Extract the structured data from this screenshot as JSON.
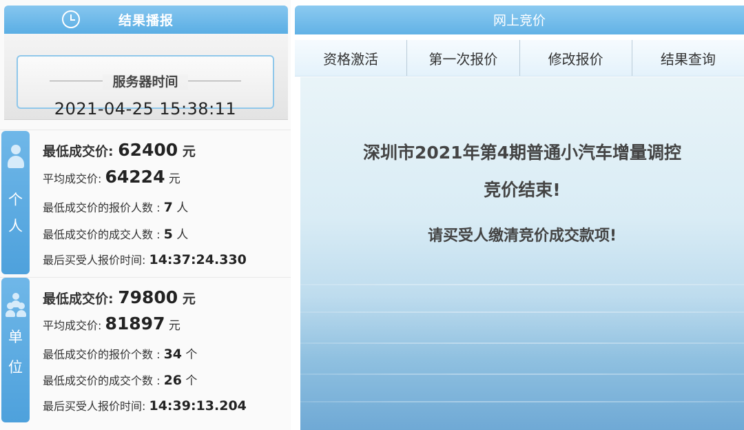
{
  "left_panel": {
    "header_title": "结果播报",
    "server_time_label": "服务器时间",
    "server_time_value": "2021-04-25 15:38:11"
  },
  "personal": {
    "tab_label_1": "个",
    "tab_label_2": "人",
    "lowest_price_label": "最低成交价: ",
    "lowest_price_value": "62400",
    "lowest_price_unit": " 元",
    "avg_price_label": "平均成交价: ",
    "avg_price_value": "64224",
    "avg_price_unit": " 元",
    "lowest_bid_count_label": "最低成交价的报价人数 : ",
    "lowest_bid_count_value": "7",
    "lowest_bid_count_unit": " 人",
    "lowest_deal_count_label": "最低成交价的成交人数 : ",
    "lowest_deal_count_value": "5",
    "lowest_deal_count_unit": " 人",
    "last_bid_time_label": "最后买受人报价时间: ",
    "last_bid_time_value": "14:37:24.330"
  },
  "unit": {
    "tab_label_1": "单",
    "tab_label_2": "位",
    "lowest_price_label": "最低成交价: ",
    "lowest_price_value": "79800",
    "lowest_price_unit": " 元",
    "avg_price_label": "平均成交价: ",
    "avg_price_value": "81897",
    "avg_price_unit": " 元",
    "lowest_bid_count_label": "最低成交价的报价个数 : ",
    "lowest_bid_count_value": "34",
    "lowest_bid_count_unit": " 个",
    "lowest_deal_count_label": "最低成交价的成交个数 : ",
    "lowest_deal_count_value": "26",
    "lowest_deal_count_unit": " 个",
    "last_bid_time_label": "最后买受人报价时间: ",
    "last_bid_time_value": "14:39:13.204"
  },
  "right_panel": {
    "header_title": "网上竞价",
    "tabs": [
      "资格激活",
      "第一次报价",
      "修改报价",
      "结果查询"
    ],
    "message_line1": "深圳市2021年第4期普通小汽车增量调控",
    "message_line2": "竞价结束!",
    "message_line3": "请买受人缴清竞价成交款项!"
  },
  "colors": {
    "accent_blue": "#5aaee4",
    "tab_blue": "#4ea1dc",
    "text_dark": "#333333"
  },
  "icons": {
    "header_icon": "clock-icon",
    "personal_icon": "person-icon",
    "unit_icon": "group-icon"
  }
}
